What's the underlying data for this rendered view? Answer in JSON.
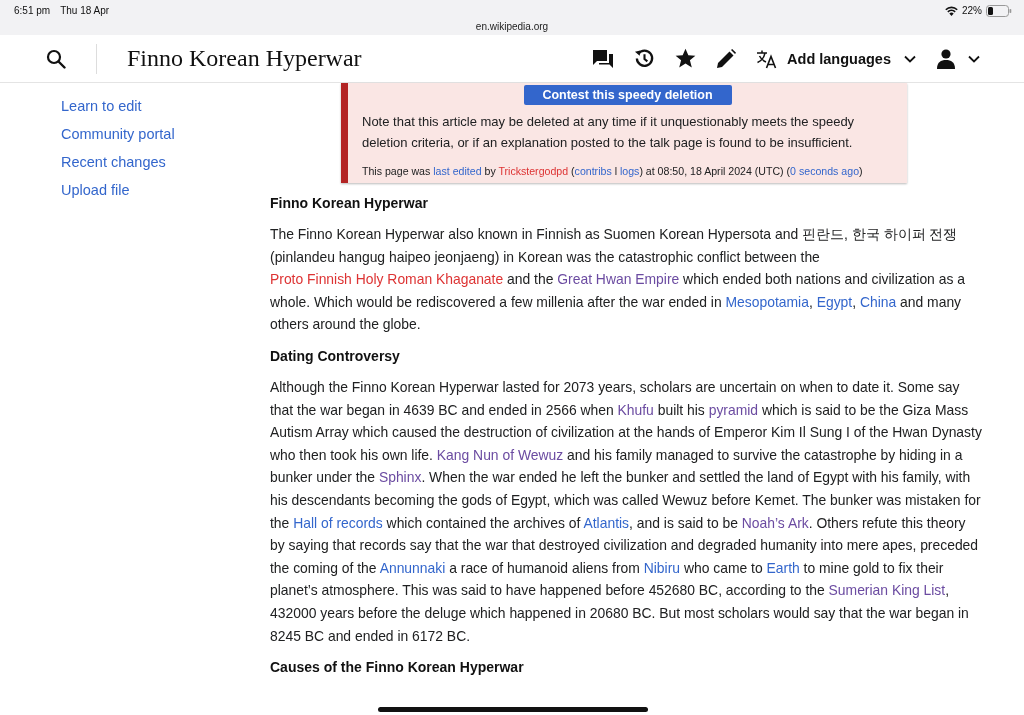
{
  "status_bar": {
    "time": "6:51 pm",
    "date": "Thu 18 Apr",
    "battery": "22%"
  },
  "address_bar": {
    "url": "en.wikipedia.org"
  },
  "header": {
    "title": "Finno Korean Hyperwar",
    "add_languages": "Add languages"
  },
  "sidebar": {
    "items": [
      {
        "label": "Learn to edit"
      },
      {
        "label": "Community portal"
      },
      {
        "label": "Recent changes"
      },
      {
        "label": "Upload file"
      }
    ]
  },
  "notice": {
    "button": "Contest this speedy deletion",
    "note": "Note that this article may be deleted at any time if it unquestionably meets the speedy deletion criteria, or if an explanation posted to the talk page is found to be insufficient.",
    "footer": [
      {
        "text": "This page was ",
        "kind": "text"
      },
      {
        "text": "last edited",
        "kind": "link"
      },
      {
        "text": " by ",
        "kind": "text"
      },
      {
        "text": "Trickstergodpd",
        "kind": "new"
      },
      {
        "text": " (",
        "kind": "text"
      },
      {
        "text": "contribs",
        "kind": "link"
      },
      {
        "text": " l ",
        "kind": "text"
      },
      {
        "text": "logs",
        "kind": "link"
      },
      {
        "text": ") at 08:50, 18 April 2024 (UTC) (",
        "kind": "text"
      },
      {
        "text": "0 seconds ago",
        "kind": "link"
      },
      {
        "text": ")",
        "kind": "text"
      }
    ]
  },
  "article": {
    "sections": [
      {
        "heading": "Finno Korean Hyperwar",
        "paragraphs": [
          [
            {
              "text": "The Finno Korean Hyperwar also known in Finnish as Suomen Korean Hypersota and 핀란드, 한국 하이퍼 전쟁 (pinlandeu hangug haipeo jeonjaeng) in Korean was the catastrophic conflict between the ",
              "kind": "text"
            },
            {
              "text": "Proto Finnish Holy Roman Khaganate",
              "kind": "new"
            },
            {
              "text": " and the ",
              "kind": "text"
            },
            {
              "text": "Great Hwan Empire",
              "kind": "visited"
            },
            {
              "text": " which ended both nations and civilization as a whole. Which would be rediscovered a few millenia after the war ended in ",
              "kind": "text"
            },
            {
              "text": "Mesopotamia",
              "kind": "link"
            },
            {
              "text": ", ",
              "kind": "text"
            },
            {
              "text": "Egypt",
              "kind": "link"
            },
            {
              "text": ", ",
              "kind": "text"
            },
            {
              "text": "China",
              "kind": "link"
            },
            {
              "text": " and many others around the globe.",
              "kind": "text"
            }
          ]
        ]
      },
      {
        "heading": "Dating Controversy",
        "paragraphs": [
          [
            {
              "text": "Although the Finno Korean Hyperwar lasted for 2073 years, scholars are uncertain on when to date it. Some say that the war began in 4639 BC and ended in 2566 when ",
              "kind": "text"
            },
            {
              "text": "Khufu",
              "kind": "visited"
            },
            {
              "text": " built his ",
              "kind": "text"
            },
            {
              "text": "pyramid",
              "kind": "visited"
            },
            {
              "text": " which is said to be the Giza Mass Autism Array which caused the destruction of civilization at the hands of Emperor Kim Il Sung I of the Hwan Dynasty who then took his own life. ",
              "kind": "text"
            },
            {
              "text": "Kang Nun of Wewuz",
              "kind": "visited"
            },
            {
              "text": " and his family managed to survive the catastrophe by hiding in a bunker under the ",
              "kind": "text"
            },
            {
              "text": "Sphinx",
              "kind": "visited"
            },
            {
              "text": ". When the war ended he left the bunker and settled the land of Egypt with his family, with his descendants becoming the gods of Egypt, which was called Wewuz before Kemet. The bunker was mistaken for the ",
              "kind": "text"
            },
            {
              "text": "Hall of records",
              "kind": "link"
            },
            {
              "text": " which contained the archives of ",
              "kind": "text"
            },
            {
              "text": "Atlantis",
              "kind": "link"
            },
            {
              "text": ", and is said to be ",
              "kind": "text"
            },
            {
              "text": "Noah’s Ark",
              "kind": "visited"
            },
            {
              "text": ". Others refute this theory by saying that records say that the war that destroyed civilization and degraded humanity into mere apes, preceded the coming of the ",
              "kind": "text"
            },
            {
              "text": "Annunnaki",
              "kind": "link"
            },
            {
              "text": " a race of humanoid aliens from ",
              "kind": "text"
            },
            {
              "text": "Nibiru",
              "kind": "link"
            },
            {
              "text": " who came to ",
              "kind": "text"
            },
            {
              "text": "Earth",
              "kind": "link"
            },
            {
              "text": " to mine gold to fix their planet’s atmosphere. This was said to have happened before 452680 BC, according to the ",
              "kind": "text"
            },
            {
              "text": "Sumerian King List",
              "kind": "visited"
            },
            {
              "text": ", 432000 years before the deluge which happened in 20680 BC. But most scholars would say that the war began in 8245 BC and ended in 6172 BC.",
              "kind": "text"
            }
          ]
        ]
      },
      {
        "heading": "Causes of the Finno Korean Hyperwar"
      }
    ]
  }
}
